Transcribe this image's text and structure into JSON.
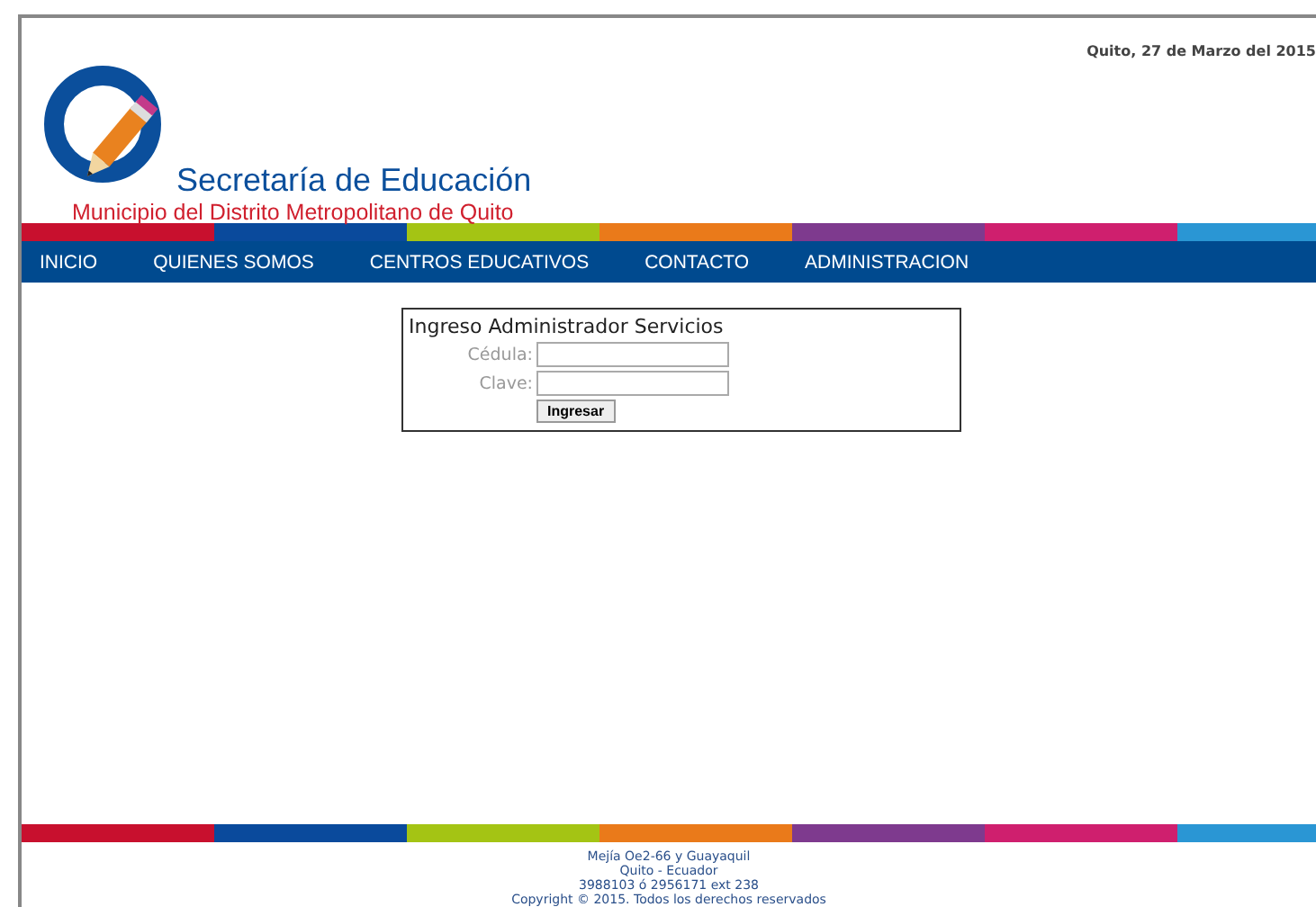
{
  "header": {
    "date": "Quito, 27 de Marzo del 2015",
    "title": "Secretaría de Educación",
    "subtitle": "Municipio del Distrito Metropolitano de Quito"
  },
  "stripes": [
    {
      "color": "#c8102e"
    },
    {
      "color": "#0a4a9c"
    },
    {
      "color": "#a4c414"
    },
    {
      "color": "#ea7a1a"
    },
    {
      "color": "#7e3a8e"
    },
    {
      "color": "#cf1f6e"
    },
    {
      "color": "#2a96d4"
    }
  ],
  "nav": [
    "INICIO",
    "QUIENES SOMOS",
    "CENTROS EDUCATIVOS",
    "CONTACTO",
    "ADMINISTRACION"
  ],
  "login": {
    "title": "Ingreso Administrador Servicios",
    "fields": [
      {
        "label": "Cédula:"
      },
      {
        "label": "Clave:"
      }
    ],
    "button": "Ingresar"
  },
  "footer": [
    "Mejía Oe2-66 y Guayaquil",
    "Quito - Ecuador",
    "3988103 ó 2956171 ext 238",
    "Copyright © 2015. Todos los derechos reservados"
  ]
}
